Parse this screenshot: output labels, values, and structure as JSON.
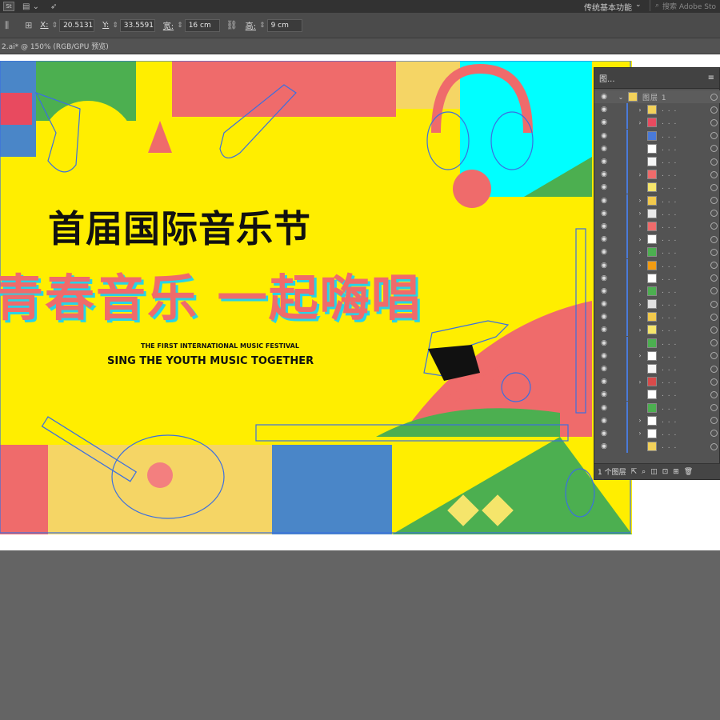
{
  "app": {
    "logo": "St",
    "workspace": "传统基本功能",
    "stock_search_placeholder": "搜索 Adobe Sto"
  },
  "control_bar": {
    "x_label": "X:",
    "x_value": "20.5131",
    "y_label": "Y:",
    "y_value": "33.5591",
    "w_label": "宽:",
    "w_value": "16 cm",
    "h_label": "高:",
    "h_value": "9 cm"
  },
  "document_tab": {
    "title": "2.ai* @ 150% (RGB/GPU 预览)"
  },
  "artwork": {
    "title_cn": "首届国际音乐节",
    "slogan_cn": "青春音乐 一起嗨唱",
    "subtitle_en_small": "THE FIRST INTERNATIONAL MUSIC FESTIVAL",
    "subtitle_en": "SING THE YOUTH MUSIC TOGETHER"
  },
  "layers_panel": {
    "tab_label": "图...",
    "layer_name": "图层 1",
    "footer_text": "1 个图层",
    "sublayers": [
      {
        "label": ". . .",
        "thumb": "#f2d15a",
        "chev": true
      },
      {
        "label": ". . .",
        "thumb": "#e84a5f",
        "chev": true
      },
      {
        "label": ". . .",
        "thumb": "#4a7ad8",
        "chev": false
      },
      {
        "label": ". . .",
        "thumb": "#ffffff",
        "chev": false
      },
      {
        "label": ". . .",
        "thumb": "#f5f5f5",
        "chev": false
      },
      {
        "label": ". . .",
        "thumb": "#ef6b6b",
        "chev": true
      },
      {
        "label": ". . .",
        "thumb": "#f5e56b",
        "chev": false
      },
      {
        "label": ". . .",
        "thumb": "#f2c94c",
        "chev": true
      },
      {
        "label": ". . .",
        "thumb": "#e8e8e8",
        "chev": true
      },
      {
        "label": ". . .",
        "thumb": "#ef6b6b",
        "chev": true
      },
      {
        "label": ". . .",
        "thumb": "#ffffff",
        "chev": true
      },
      {
        "label": ". . .",
        "thumb": "#4caf50",
        "chev": true
      },
      {
        "label": ". . .",
        "thumb": "#f39c12",
        "chev": true
      },
      {
        "label": ". . .",
        "thumb": "#ffffff",
        "chev": false
      },
      {
        "label": ". . .",
        "thumb": "#4caf50",
        "chev": true
      },
      {
        "label": ". . .",
        "thumb": "#e0e0e0",
        "chev": true
      },
      {
        "label": ". . .",
        "thumb": "#f2c94c",
        "chev": true
      },
      {
        "label": ". . .",
        "thumb": "#f5e56b",
        "chev": true
      },
      {
        "label": ". . .",
        "thumb": "#4caf50",
        "chev": false
      },
      {
        "label": ". . .",
        "thumb": "#ffffff",
        "chev": true
      },
      {
        "label": ". . .",
        "thumb": "#f5f5f5",
        "chev": false
      },
      {
        "label": ". . .",
        "thumb": "#d94a4a",
        "chev": true
      },
      {
        "label": ". . .",
        "thumb": "#ffffff",
        "chev": false
      },
      {
        "label": ". . .",
        "thumb": "#4caf50",
        "chev": false
      },
      {
        "label": ". . .",
        "thumb": "#ffffff",
        "chev": true
      },
      {
        "label": ". . .",
        "thumb": "#ffffff",
        "chev": true
      },
      {
        "label": ". . .",
        "thumb": "#f2d15a",
        "chev": false
      }
    ]
  },
  "colors": {
    "yellow": "#ffee00",
    "coral": "#ef6b6b",
    "cyan": "#28d3e6",
    "green": "#4caf50",
    "blue": "#4a86c8",
    "sand": "#f5d565",
    "selection": "#3b6fe0"
  }
}
